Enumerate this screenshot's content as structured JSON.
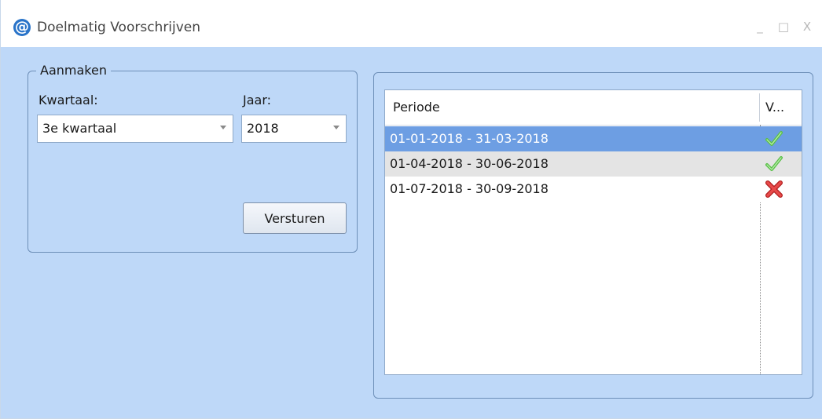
{
  "window": {
    "title": "Doelmatig Voorschrijven",
    "app_icon_glyph": "@",
    "controls": {
      "minimize": "_",
      "maximize": "□",
      "close": "X"
    }
  },
  "create_group": {
    "legend": "Aanmaken",
    "quarter_label": "Kwartaal:",
    "quarter_value": "3e kwartaal",
    "year_label": "Jaar:",
    "year_value": "2018",
    "send_button": "Versturen"
  },
  "list": {
    "columns": {
      "period": "Periode",
      "status": "V..."
    },
    "rows": [
      {
        "period": "01-01-2018 - 31-03-2018",
        "status": "check-icon",
        "selected": true
      },
      {
        "period": "01-04-2018 - 30-06-2018",
        "status": "check-icon",
        "selected": false
      },
      {
        "period": "01-07-2018 - 30-09-2018",
        "status": "cross-icon",
        "selected": false
      }
    ]
  },
  "colors": {
    "window_background": "#bed8f8",
    "selected_row": "#6d9ee3",
    "alternate_row": "#e4e4e4",
    "check": "#5cc04b",
    "cross": "#d92c2c"
  }
}
